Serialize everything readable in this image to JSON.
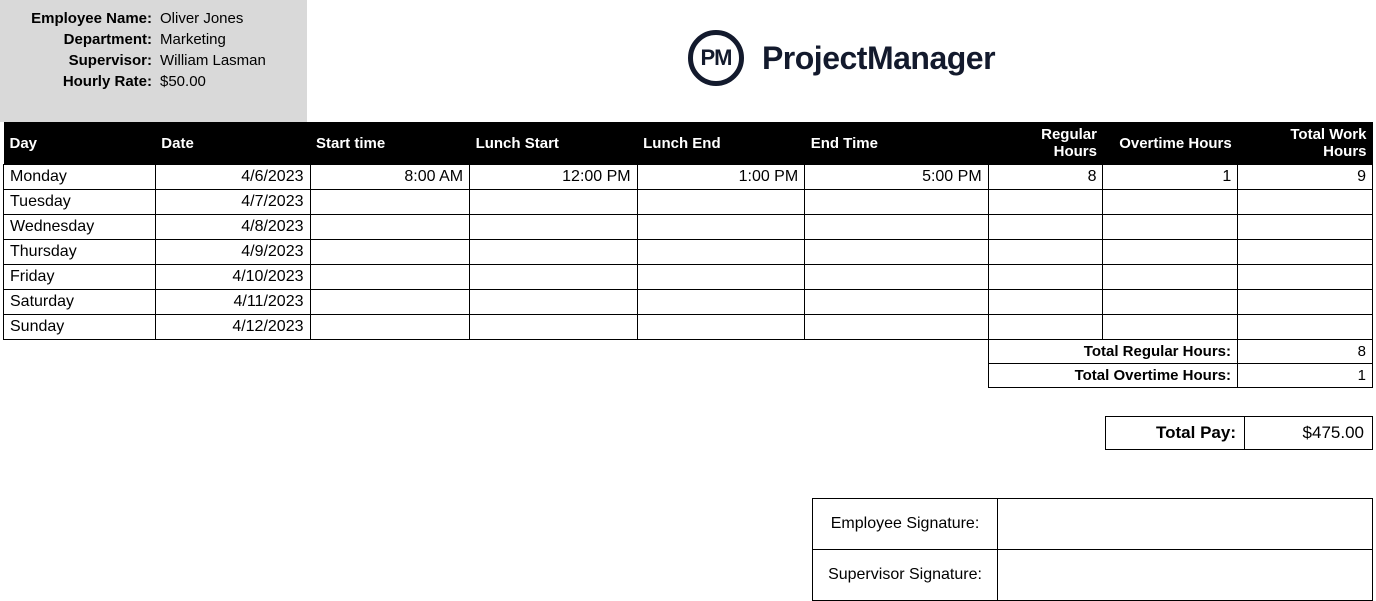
{
  "employee": {
    "name_label": "Employee Name:",
    "name_value": "Oliver Jones",
    "dept_label": "Department:",
    "dept_value": "Marketing",
    "sup_label": "Supervisor:",
    "sup_value": "William Lasman",
    "rate_label": "Hourly Rate:",
    "rate_value": "$50.00"
  },
  "brand": {
    "mark": "PM",
    "name": "ProjectManager"
  },
  "columns": {
    "day": "Day",
    "date": "Date",
    "start": "Start time",
    "lunch_start": "Lunch Start",
    "lunch_end": "Lunch End",
    "end": "End Time",
    "regular": "Regular Hours",
    "overtime": "Overtime Hours",
    "total": "Total Work Hours"
  },
  "rows": [
    {
      "day": "Monday",
      "date": "4/6/2023",
      "start": "8:00 AM",
      "lunch_start": "12:00 PM",
      "lunch_end": "1:00 PM",
      "end": "5:00 PM",
      "regular": "8",
      "overtime": "1",
      "total": "9"
    },
    {
      "day": "Tuesday",
      "date": "4/7/2023",
      "start": "",
      "lunch_start": "",
      "lunch_end": "",
      "end": "",
      "regular": "",
      "overtime": "",
      "total": ""
    },
    {
      "day": "Wednesday",
      "date": "4/8/2023",
      "start": "",
      "lunch_start": "",
      "lunch_end": "",
      "end": "",
      "regular": "",
      "overtime": "",
      "total": ""
    },
    {
      "day": "Thursday",
      "date": "4/9/2023",
      "start": "",
      "lunch_start": "",
      "lunch_end": "",
      "end": "",
      "regular": "",
      "overtime": "",
      "total": ""
    },
    {
      "day": "Friday",
      "date": "4/10/2023",
      "start": "",
      "lunch_start": "",
      "lunch_end": "",
      "end": "",
      "regular": "",
      "overtime": "",
      "total": ""
    },
    {
      "day": "Saturday",
      "date": "4/11/2023",
      "start": "",
      "lunch_start": "",
      "lunch_end": "",
      "end": "",
      "regular": "",
      "overtime": "",
      "total": ""
    },
    {
      "day": "Sunday",
      "date": "4/12/2023",
      "start": "",
      "lunch_start": "",
      "lunch_end": "",
      "end": "",
      "regular": "",
      "overtime": "",
      "total": ""
    }
  ],
  "totals": {
    "regular_label": "Total Regular Hours:",
    "regular_value": "8",
    "overtime_label": "Total Overtime Hours:",
    "overtime_value": "1",
    "pay_label": "Total Pay:",
    "pay_value": "$475.00"
  },
  "signatures": {
    "employee_label": "Employee Signature:",
    "supervisor_label": "Supervisor Signature:"
  }
}
